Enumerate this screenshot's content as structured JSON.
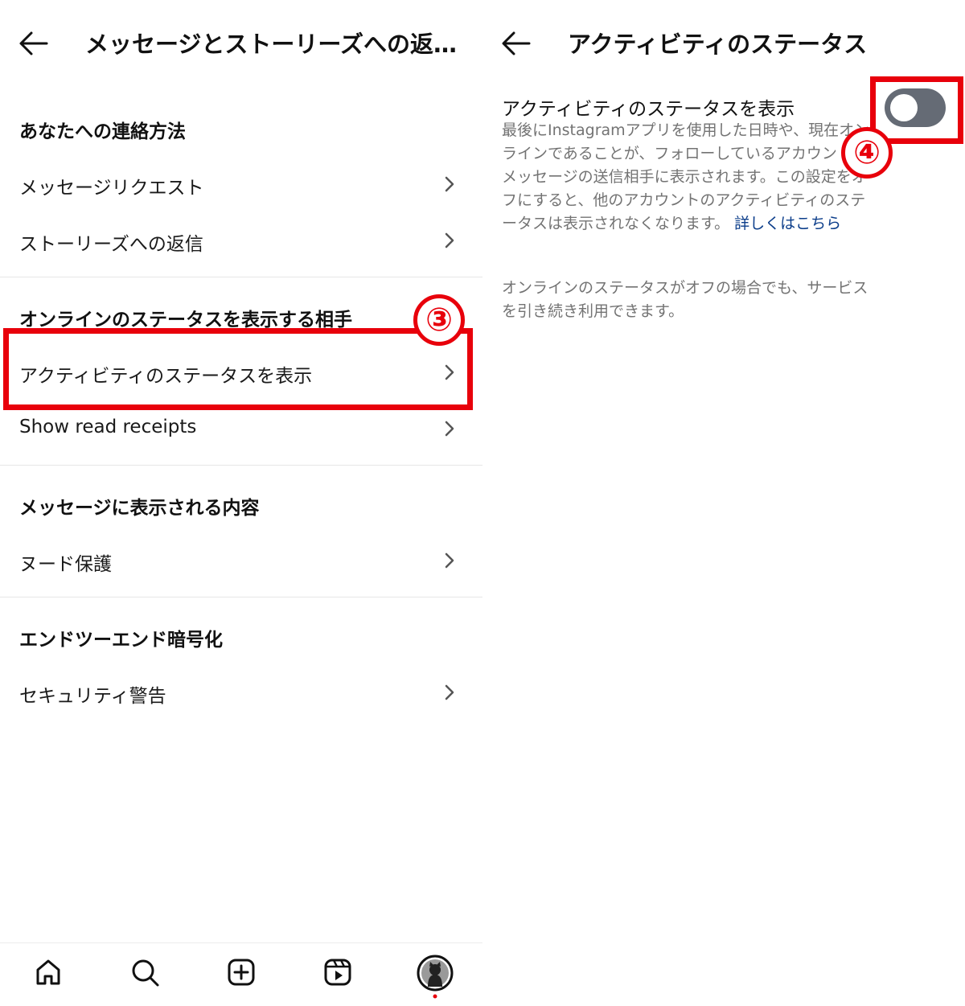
{
  "left": {
    "title": "メッセージとストーリーズへの返…",
    "sections": [
      {
        "heading": "あなたへの連絡方法",
        "items": [
          "メッセージリクエスト",
          "ストーリーズへの返信"
        ]
      },
      {
        "heading": "オンラインのステータスを表示する相手",
        "items": [
          "アクティビティのステータスを表示",
          "Show read receipts"
        ]
      },
      {
        "heading": "メッセージに表示される内容",
        "items": [
          "ヌード保護"
        ]
      },
      {
        "heading": "エンドツーエンド暗号化",
        "items": [
          "セキュリティ警告"
        ]
      }
    ],
    "annotation_step": "③",
    "bottom_nav": [
      "home-icon",
      "search-icon",
      "create-icon",
      "reels-icon",
      "profile-avatar"
    ]
  },
  "right": {
    "title": "アクティビティのステータス",
    "setting_label": "アクティビティのステータスを表示",
    "description": "最後にInstagramアプリを使用した日時や、現在オンラインであることが、フォローしているアカウントとメッセージの送信相手に表示されます。この設定をオフにすると、他のアカウントのアクティビティのステータスは表示されなくなります。",
    "learn_more": "詳しくはこちら",
    "note": "オンラインのステータスがオフの場合でも、サービスを引き続き利用できます。",
    "toggle_on": false,
    "annotation_step": "④"
  },
  "colors": {
    "annotation": "#e8000b",
    "toggle_off": "#656b75",
    "link": "#0b3d8a",
    "secondary_text": "#737373"
  }
}
